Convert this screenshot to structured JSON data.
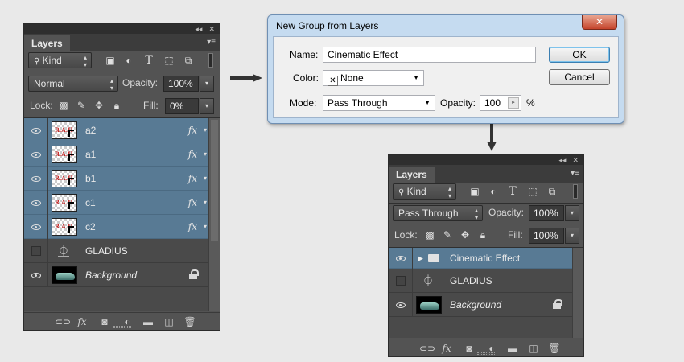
{
  "panel_left": {
    "tab": "Layers",
    "filter_kind": "Kind",
    "blend_mode": "Normal",
    "opacity_label": "Opacity:",
    "opacity_value": "100%",
    "lock_label": "Lock:",
    "fill_label": "Fill:",
    "fill_value": "0%",
    "layers": [
      {
        "name": "a2",
        "fx": "fx",
        "selected": true
      },
      {
        "name": "a1",
        "fx": "fx",
        "selected": true
      },
      {
        "name": "b1",
        "fx": "fx",
        "selected": true
      },
      {
        "name": "c1",
        "fx": "fx",
        "selected": true
      },
      {
        "name": "c2",
        "fx": "fx",
        "selected": true
      },
      {
        "name": "GLADIUS",
        "visible": false
      },
      {
        "name": "Background",
        "locked": true
      }
    ]
  },
  "dialog": {
    "title": "New Group from Layers",
    "close": "✕",
    "name_label": "Name:",
    "name_value": "Cinematic Effect",
    "color_label": "Color:",
    "color_value": "None",
    "mode_label": "Mode:",
    "mode_value": "Pass Through",
    "opacity_label": "Opacity:",
    "opacity_value": "100",
    "percent": "%",
    "ok": "OK",
    "cancel": "Cancel"
  },
  "panel_right": {
    "tab": "Layers",
    "filter_kind": "Kind",
    "blend_mode": "Pass Through",
    "opacity_label": "Opacity:",
    "opacity_value": "100%",
    "lock_label": "Lock:",
    "fill_label": "Fill:",
    "fill_value": "100%",
    "layers": [
      {
        "name": "Cinematic Effect",
        "type": "group",
        "selected": true
      },
      {
        "name": "GLADIUS",
        "visible": false
      },
      {
        "name": "Background",
        "locked": true
      }
    ]
  },
  "colors": {
    "panel_bg": "#535353",
    "selected_layer": "#587a94",
    "dialog_frame": "#c5dbf0",
    "page_bg": "#e9e9e9"
  }
}
